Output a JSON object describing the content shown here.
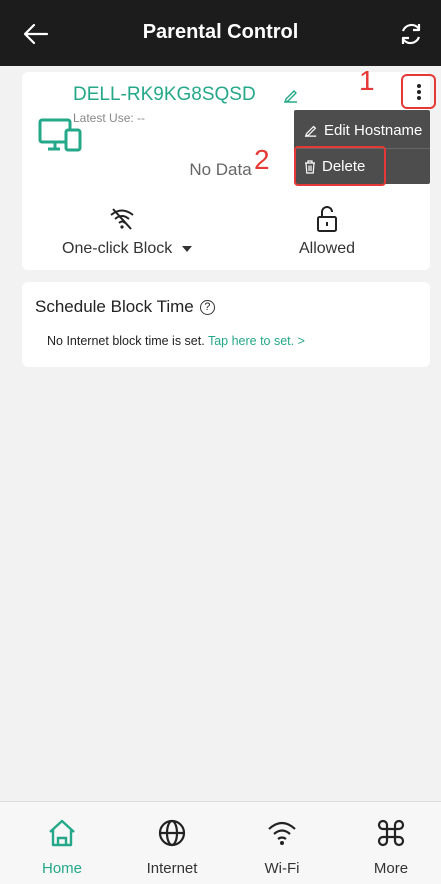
{
  "header": {
    "title": "Parental Control"
  },
  "device": {
    "name": "DELL-RK9KG8SQSD",
    "latest_use": "Latest Use: --",
    "no_data": "No Data",
    "block_label": "One-click Block",
    "status_label": "Allowed"
  },
  "menu": {
    "edit_label": "Edit Hostname",
    "delete_label": "Delete"
  },
  "annotations": {
    "one": "1",
    "two": "2"
  },
  "schedule": {
    "title": "Schedule Block Time",
    "message": "No Internet block time is set.",
    "link": "Tap here to set.",
    "link_arrow": ">"
  },
  "nav": {
    "home": "Home",
    "internet": "Internet",
    "wifi": "Wi-Fi",
    "more": "More"
  },
  "colors": {
    "accent": "#25a889",
    "header_bg": "#1c1c1c",
    "annotation": "#e53935"
  }
}
